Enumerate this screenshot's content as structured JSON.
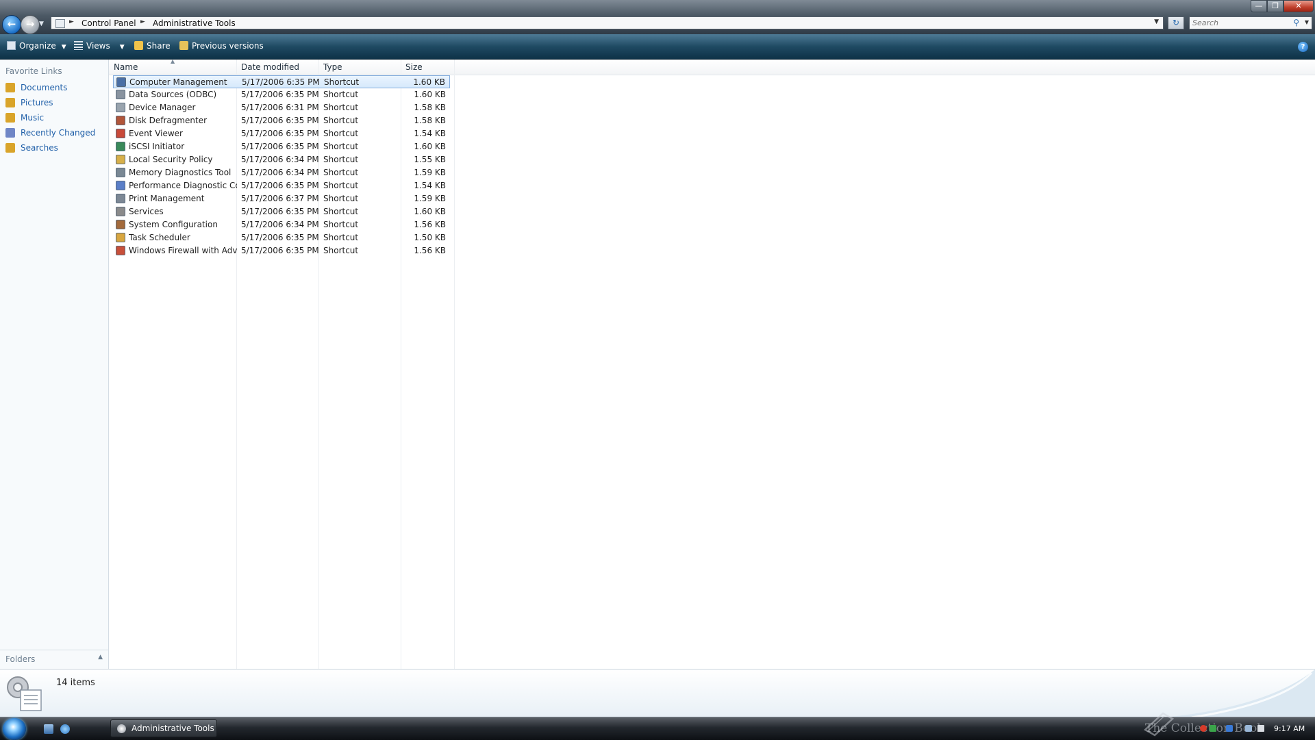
{
  "window": {
    "breadcrumbs": [
      "Control Panel",
      "Administrative Tools"
    ],
    "search": {
      "placeholder": "Search"
    }
  },
  "toolbar": {
    "organize_label": "Organize",
    "views_label": "Views",
    "share_label": "Share",
    "previous_versions_label": "Previous versions"
  },
  "nav": {
    "favorite_links_title": "Favorite Links",
    "links": [
      {
        "label": "Documents",
        "icon": "documents-icon",
        "color": "#d9a42a"
      },
      {
        "label": "Pictures",
        "icon": "pictures-icon",
        "color": "#d9a42a"
      },
      {
        "label": "Music",
        "icon": "music-icon",
        "color": "#d9a42a"
      },
      {
        "label": "Recently Changed",
        "icon": "recently-changed-icon",
        "color": "#6f86c6"
      },
      {
        "label": "Searches",
        "icon": "searches-icon",
        "color": "#d9a42a"
      }
    ],
    "folders_label": "Folders"
  },
  "files": {
    "columns": [
      "Name",
      "Date modified",
      "Type",
      "Size"
    ],
    "rows": [
      {
        "name": "Computer Management",
        "date": "5/17/2006 6:35 PM",
        "type": "Shortcut",
        "size": "1.60 KB",
        "icon": "computer-management-icon",
        "color": "#4a6fa5"
      },
      {
        "name": "Data Sources (ODBC)",
        "date": "5/17/2006 6:35 PM",
        "type": "Shortcut",
        "size": "1.60 KB",
        "icon": "data-sources-icon",
        "color": "#8a94a0"
      },
      {
        "name": "Device Manager",
        "date": "5/17/2006 6:31 PM",
        "type": "Shortcut",
        "size": "1.58 KB",
        "icon": "device-manager-icon",
        "color": "#9aa4ae"
      },
      {
        "name": "Disk Defragmenter",
        "date": "5/17/2006 6:35 PM",
        "type": "Shortcut",
        "size": "1.58 KB",
        "icon": "disk-defragmenter-icon",
        "color": "#b2563a"
      },
      {
        "name": "Event Viewer",
        "date": "5/17/2006 6:35 PM",
        "type": "Shortcut",
        "size": "1.54 KB",
        "icon": "event-viewer-icon",
        "color": "#c94a3a"
      },
      {
        "name": "iSCSI Initiator",
        "date": "5/17/2006 6:35 PM",
        "type": "Shortcut",
        "size": "1.60 KB",
        "icon": "iscsi-initiator-icon",
        "color": "#3a8a5a"
      },
      {
        "name": "Local Security Policy",
        "date": "5/17/2006 6:34 PM",
        "type": "Shortcut",
        "size": "1.55 KB",
        "icon": "local-security-policy-icon",
        "color": "#d8b04a"
      },
      {
        "name": "Memory Diagnostics Tool",
        "date": "5/17/2006 6:34 PM",
        "type": "Shortcut",
        "size": "1.59 KB",
        "icon": "memory-diagnostics-icon",
        "color": "#7a8894"
      },
      {
        "name": "Performance Diagnostic Co...",
        "date": "5/17/2006 6:35 PM",
        "type": "Shortcut",
        "size": "1.54 KB",
        "icon": "performance-diagnostic-icon",
        "color": "#5b7fc8"
      },
      {
        "name": "Print Management",
        "date": "5/17/2006 6:37 PM",
        "type": "Shortcut",
        "size": "1.59 KB",
        "icon": "print-management-icon",
        "color": "#7d8895"
      },
      {
        "name": "Services",
        "date": "5/17/2006 6:35 PM",
        "type": "Shortcut",
        "size": "1.60 KB",
        "icon": "services-icon",
        "color": "#8b8b8b"
      },
      {
        "name": "System Configuration",
        "date": "5/17/2006 6:34 PM",
        "type": "Shortcut",
        "size": "1.56 KB",
        "icon": "system-configuration-icon",
        "color": "#a36a3c"
      },
      {
        "name": "Task Scheduler",
        "date": "5/17/2006 6:35 PM",
        "type": "Shortcut",
        "size": "1.50 KB",
        "icon": "task-scheduler-icon",
        "color": "#d8a640"
      },
      {
        "name": "Windows Firewall with Adv...",
        "date": "5/17/2006 6:35 PM",
        "type": "Shortcut",
        "size": "1.56 KB",
        "icon": "windows-firewall-icon",
        "color": "#c8503a"
      }
    ],
    "selected_index": 0
  },
  "details": {
    "item_count": "14 items"
  },
  "taskbar": {
    "window_button_label": "Administrative Tools",
    "watermark": "The Collection Book",
    "clock": "9:17 AM"
  }
}
